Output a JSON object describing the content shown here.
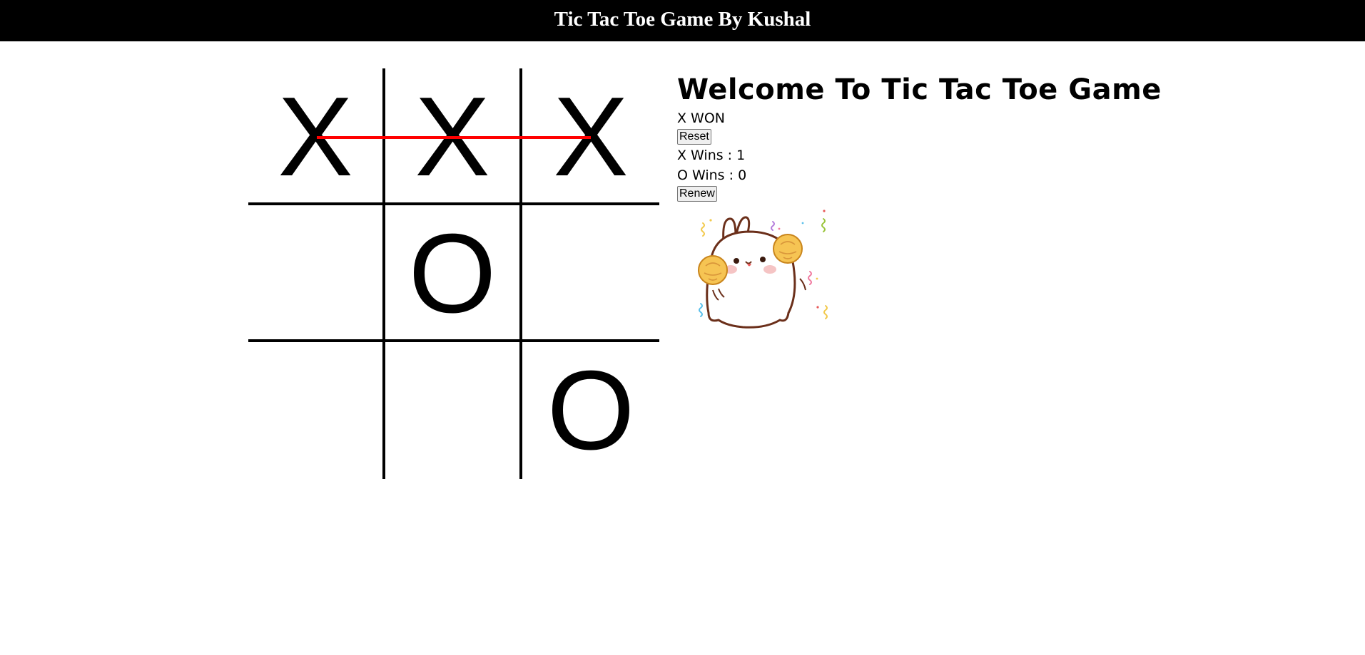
{
  "header": {
    "title": "Tic Tac Toe Game By Kushal"
  },
  "board": {
    "cells": [
      "X",
      "X",
      "X",
      "",
      "O",
      "",
      "",
      "",
      "O"
    ],
    "winning_row": "top",
    "line_color": "#ff0000"
  },
  "side": {
    "heading": "Welcome To Tic Tac Toe Game",
    "status": "X WON",
    "reset_label": "Reset",
    "x_wins_label": "X Wins : 1",
    "o_wins_label": "O Wins : 0",
    "renew_label": "Renew"
  },
  "mascot": {
    "icon": "cheering-bunny-icon"
  }
}
